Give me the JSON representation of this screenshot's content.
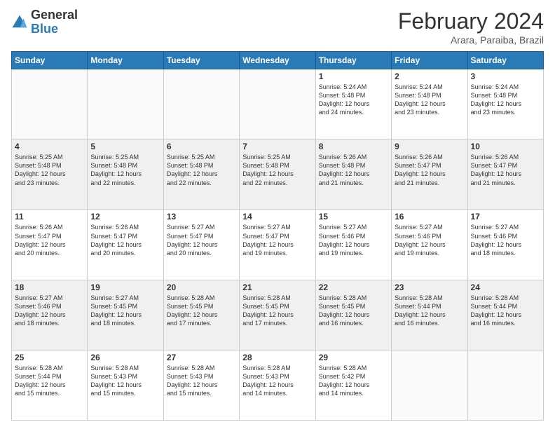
{
  "logo": {
    "general": "General",
    "blue": "Blue"
  },
  "header": {
    "month": "February 2024",
    "location": "Arara, Paraiba, Brazil"
  },
  "days_of_week": [
    "Sunday",
    "Monday",
    "Tuesday",
    "Wednesday",
    "Thursday",
    "Friday",
    "Saturday"
  ],
  "weeks": [
    [
      {
        "day": "",
        "info": ""
      },
      {
        "day": "",
        "info": ""
      },
      {
        "day": "",
        "info": ""
      },
      {
        "day": "",
        "info": ""
      },
      {
        "day": "1",
        "info": "Sunrise: 5:24 AM\nSunset: 5:48 PM\nDaylight: 12 hours\nand 24 minutes."
      },
      {
        "day": "2",
        "info": "Sunrise: 5:24 AM\nSunset: 5:48 PM\nDaylight: 12 hours\nand 23 minutes."
      },
      {
        "day": "3",
        "info": "Sunrise: 5:24 AM\nSunset: 5:48 PM\nDaylight: 12 hours\nand 23 minutes."
      }
    ],
    [
      {
        "day": "4",
        "info": "Sunrise: 5:25 AM\nSunset: 5:48 PM\nDaylight: 12 hours\nand 23 minutes."
      },
      {
        "day": "5",
        "info": "Sunrise: 5:25 AM\nSunset: 5:48 PM\nDaylight: 12 hours\nand 22 minutes."
      },
      {
        "day": "6",
        "info": "Sunrise: 5:25 AM\nSunset: 5:48 PM\nDaylight: 12 hours\nand 22 minutes."
      },
      {
        "day": "7",
        "info": "Sunrise: 5:25 AM\nSunset: 5:48 PM\nDaylight: 12 hours\nand 22 minutes."
      },
      {
        "day": "8",
        "info": "Sunrise: 5:26 AM\nSunset: 5:48 PM\nDaylight: 12 hours\nand 21 minutes."
      },
      {
        "day": "9",
        "info": "Sunrise: 5:26 AM\nSunset: 5:47 PM\nDaylight: 12 hours\nand 21 minutes."
      },
      {
        "day": "10",
        "info": "Sunrise: 5:26 AM\nSunset: 5:47 PM\nDaylight: 12 hours\nand 21 minutes."
      }
    ],
    [
      {
        "day": "11",
        "info": "Sunrise: 5:26 AM\nSunset: 5:47 PM\nDaylight: 12 hours\nand 20 minutes."
      },
      {
        "day": "12",
        "info": "Sunrise: 5:26 AM\nSunset: 5:47 PM\nDaylight: 12 hours\nand 20 minutes."
      },
      {
        "day": "13",
        "info": "Sunrise: 5:27 AM\nSunset: 5:47 PM\nDaylight: 12 hours\nand 20 minutes."
      },
      {
        "day": "14",
        "info": "Sunrise: 5:27 AM\nSunset: 5:47 PM\nDaylight: 12 hours\nand 19 minutes."
      },
      {
        "day": "15",
        "info": "Sunrise: 5:27 AM\nSunset: 5:46 PM\nDaylight: 12 hours\nand 19 minutes."
      },
      {
        "day": "16",
        "info": "Sunrise: 5:27 AM\nSunset: 5:46 PM\nDaylight: 12 hours\nand 19 minutes."
      },
      {
        "day": "17",
        "info": "Sunrise: 5:27 AM\nSunset: 5:46 PM\nDaylight: 12 hours\nand 18 minutes."
      }
    ],
    [
      {
        "day": "18",
        "info": "Sunrise: 5:27 AM\nSunset: 5:46 PM\nDaylight: 12 hours\nand 18 minutes."
      },
      {
        "day": "19",
        "info": "Sunrise: 5:27 AM\nSunset: 5:45 PM\nDaylight: 12 hours\nand 18 minutes."
      },
      {
        "day": "20",
        "info": "Sunrise: 5:28 AM\nSunset: 5:45 PM\nDaylight: 12 hours\nand 17 minutes."
      },
      {
        "day": "21",
        "info": "Sunrise: 5:28 AM\nSunset: 5:45 PM\nDaylight: 12 hours\nand 17 minutes."
      },
      {
        "day": "22",
        "info": "Sunrise: 5:28 AM\nSunset: 5:45 PM\nDaylight: 12 hours\nand 16 minutes."
      },
      {
        "day": "23",
        "info": "Sunrise: 5:28 AM\nSunset: 5:44 PM\nDaylight: 12 hours\nand 16 minutes."
      },
      {
        "day": "24",
        "info": "Sunrise: 5:28 AM\nSunset: 5:44 PM\nDaylight: 12 hours\nand 16 minutes."
      }
    ],
    [
      {
        "day": "25",
        "info": "Sunrise: 5:28 AM\nSunset: 5:44 PM\nDaylight: 12 hours\nand 15 minutes."
      },
      {
        "day": "26",
        "info": "Sunrise: 5:28 AM\nSunset: 5:43 PM\nDaylight: 12 hours\nand 15 minutes."
      },
      {
        "day": "27",
        "info": "Sunrise: 5:28 AM\nSunset: 5:43 PM\nDaylight: 12 hours\nand 15 minutes."
      },
      {
        "day": "28",
        "info": "Sunrise: 5:28 AM\nSunset: 5:43 PM\nDaylight: 12 hours\nand 14 minutes."
      },
      {
        "day": "29",
        "info": "Sunrise: 5:28 AM\nSunset: 5:42 PM\nDaylight: 12 hours\nand 14 minutes."
      },
      {
        "day": "",
        "info": ""
      },
      {
        "day": "",
        "info": ""
      }
    ]
  ]
}
